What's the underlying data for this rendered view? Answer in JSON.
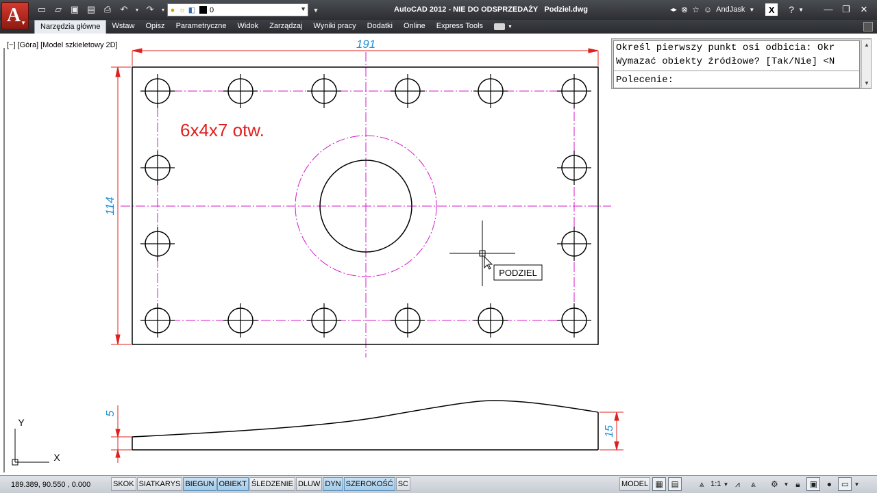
{
  "window": {
    "title": "AutoCAD 2012 - NIE DO ODSPRZEDAŻY",
    "filename": "Podziel.dwg",
    "user": "AndJask"
  },
  "qat": {
    "layer": "0"
  },
  "ribbon": {
    "tabs": [
      {
        "label": "Narzędzia główne",
        "active": true
      },
      {
        "label": "Wstaw"
      },
      {
        "label": "Opisz"
      },
      {
        "label": "Parametryczne"
      },
      {
        "label": "Widok"
      },
      {
        "label": "Zarządzaj"
      },
      {
        "label": "Wyniki pracy"
      },
      {
        "label": "Dodatki"
      },
      {
        "label": "Online"
      },
      {
        "label": "Express Tools"
      }
    ]
  },
  "viewport": {
    "controls": "[−]",
    "view": "[Góra]",
    "style": "[Model szkieletowy 2D]"
  },
  "drawing": {
    "dim_width": "191",
    "dim_height": "114",
    "dim_left": "5",
    "dim_right": "15",
    "note": "6x4x7 otw.",
    "tooltip": "PODZIEL",
    "ucs_x": "X",
    "ucs_y": "Y",
    "colors": {
      "dimension": "#e0201e",
      "dim_text": "#1f8fd6",
      "centerline": "#d417c8",
      "geometry": "#000000",
      "note": "#e0201e"
    }
  },
  "command_line": {
    "line1": "Określ pierwszy punkt osi odbicia: Okr",
    "line2": "Wymazać obiekty źródłowe? [Tak/Nie] <N",
    "prompt": "Polecenie:"
  },
  "statusbar": {
    "coords": "189.389, 90.550 , 0.000",
    "toggles": [
      {
        "label": "SKOK",
        "on": false
      },
      {
        "label": "SIATKARYS",
        "on": false
      },
      {
        "label": "BIEGUN",
        "on": true
      },
      {
        "label": "OBIEKT",
        "on": true
      },
      {
        "label": "ŚLEDZENIE",
        "on": false
      },
      {
        "label": "DLUW",
        "on": false
      },
      {
        "label": "DYN",
        "on": true
      },
      {
        "label": "SZEROKOŚĆ",
        "on": true
      },
      {
        "label": "SC",
        "on": false
      }
    ],
    "model": "MODEL",
    "scale": "1:1"
  }
}
